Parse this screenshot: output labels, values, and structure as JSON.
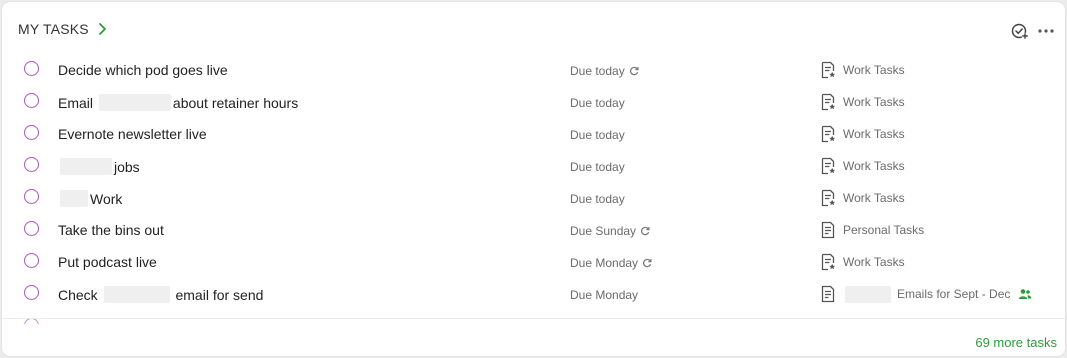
{
  "header": {
    "title": "MY TASKS"
  },
  "colors": {
    "checkbox": "#a855c7",
    "accent_green": "#2e9b3a",
    "muted_text": "#6b6b6b"
  },
  "tasks": [
    {
      "parts": [
        {
          "t": "Decide which pod goes live"
        }
      ],
      "due": "Due today",
      "recurring": true,
      "notebook_icon": "note-starred-icon",
      "notebook": "Work Tasks",
      "shared": false
    },
    {
      "parts": [
        {
          "t": "Email "
        },
        {
          "r": 72
        },
        {
          "t": "about retainer hours"
        }
      ],
      "due": "Due today",
      "recurring": false,
      "notebook_icon": "note-starred-icon",
      "notebook": "Work Tasks",
      "shared": false
    },
    {
      "parts": [
        {
          "t": "Evernote newsletter live"
        }
      ],
      "due": "Due today",
      "recurring": false,
      "notebook_icon": "note-starred-icon",
      "notebook": "Work Tasks",
      "shared": false
    },
    {
      "parts": [
        {
          "r": 52
        },
        {
          "t": "jobs"
        }
      ],
      "due": "Due today",
      "recurring": false,
      "notebook_icon": "note-starred-icon",
      "notebook": "Work Tasks",
      "shared": false
    },
    {
      "parts": [
        {
          "r": 28
        },
        {
          "t": "Work"
        }
      ],
      "due": "Due today",
      "recurring": false,
      "notebook_icon": "note-starred-icon",
      "notebook": "Work Tasks",
      "shared": false
    },
    {
      "parts": [
        {
          "t": "Take the bins out"
        }
      ],
      "due": "Due Sunday",
      "recurring": true,
      "notebook_icon": "note-icon",
      "notebook": "Personal Tasks",
      "shared": false
    },
    {
      "parts": [
        {
          "t": "Put podcast live"
        }
      ],
      "due": "Due Monday",
      "recurring": true,
      "notebook_icon": "note-starred-icon",
      "notebook": "Work Tasks",
      "shared": false
    },
    {
      "parts": [
        {
          "t": "Check "
        },
        {
          "r": 66
        },
        {
          "t": " email for send"
        }
      ],
      "due": "Due Monday",
      "recurring": false,
      "notebook_icon": "note-icon",
      "notebook": "Emails for Sept - Dec",
      "notebook_redact": 46,
      "shared": true
    }
  ],
  "footer": {
    "more_label": "69 more tasks"
  }
}
